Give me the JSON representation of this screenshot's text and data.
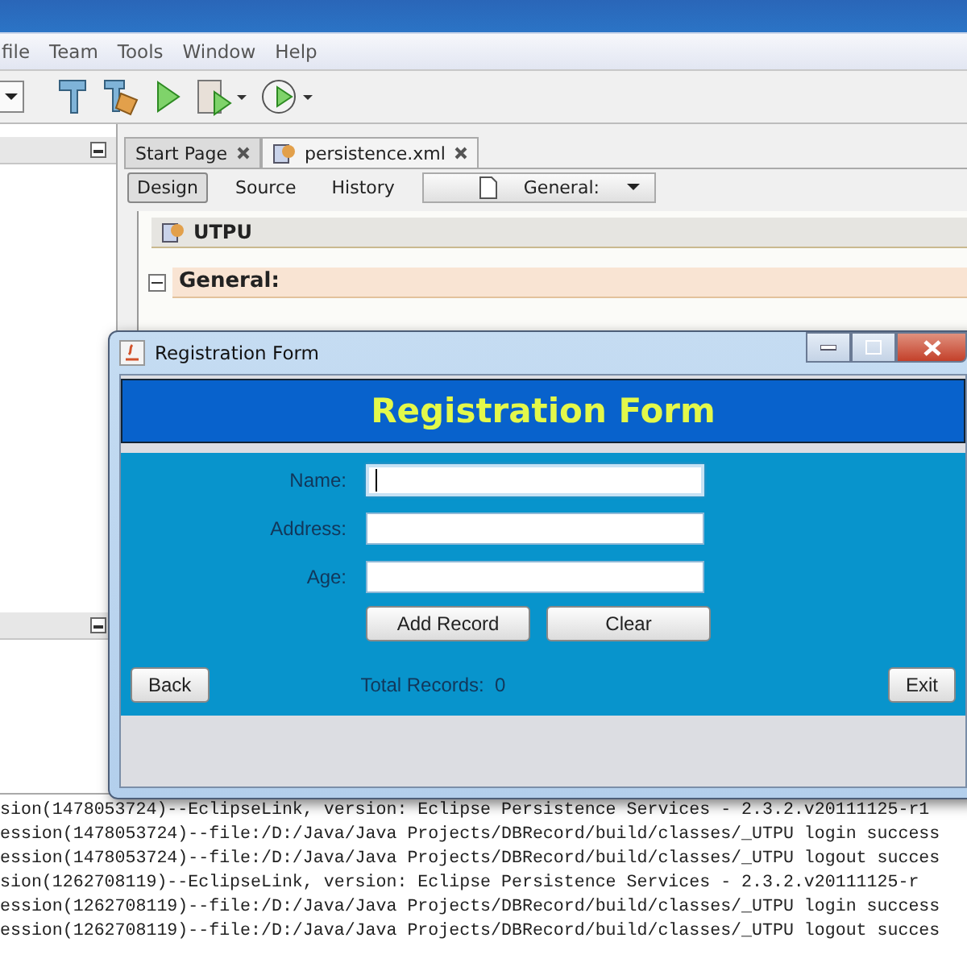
{
  "menu": [
    "file",
    "Team",
    "Tools",
    "Window",
    "Help"
  ],
  "editor_tabs": [
    {
      "label": "Start Page",
      "selected": false
    },
    {
      "label": "persistence.xml",
      "selected": true
    }
  ],
  "view_tabs": [
    {
      "label": "Design",
      "selected": true
    },
    {
      "label": "Source",
      "selected": false
    },
    {
      "label": "History",
      "selected": false
    }
  ],
  "section_dropdown": "General:",
  "unit_header": "UTPU",
  "section_header": {
    "label": "General:",
    "expanded": true
  },
  "dialog": {
    "title": "Registration Form",
    "heading": "Registration Form",
    "fields": [
      {
        "label": "Name:",
        "focused": true
      },
      {
        "label": "Address:",
        "focused": false
      },
      {
        "label": "Age:",
        "focused": false
      }
    ],
    "buttons": [
      "Add Record",
      "Clear"
    ],
    "back": "Back",
    "total_label": "Total Records:",
    "total": "0",
    "exit": "Exit"
  },
  "output_lines": [
    "sion(1478053724)--EclipseLink, version: Eclipse Persistence Services - 2.3.2.v20111125-r1",
    "ession(1478053724)--file:/D:/Java/Java Projects/DBRecord/build/classes/_UTPU login success",
    "ession(1478053724)--file:/D:/Java/Java Projects/DBRecord/build/classes/_UTPU logout succes",
    "sion(1262708119)--EclipseLink, version: Eclipse Persistence Services - 2.3.2.v20111125-r",
    "ession(1262708119)--file:/D:/Java/Java Projects/DBRecord/build/classes/_UTPU login success",
    "ession(1262708119)--file:/D:/Java/Java Projects/DBRecord/build/classes/_UTPU logout succes"
  ]
}
